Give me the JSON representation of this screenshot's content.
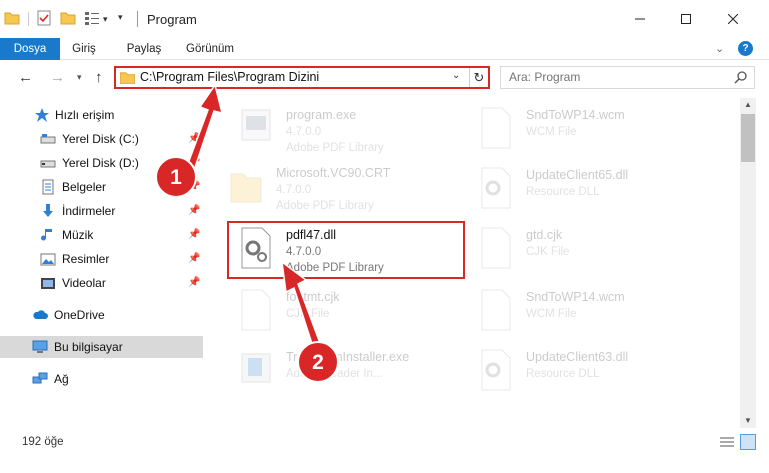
{
  "window": {
    "title": "Program"
  },
  "ribbon": {
    "tabs": [
      "Dosya",
      "Giriş",
      "Paylaş",
      "Görünüm"
    ]
  },
  "address": {
    "path": "C:\\Program Files\\Program Dizini"
  },
  "search": {
    "placeholder": "Ara: Program"
  },
  "sidebar": {
    "items": [
      {
        "label": "Hızlı erişim",
        "icon": "star-icon",
        "pinned": false
      },
      {
        "label": "Yerel Disk (C:)",
        "icon": "drive-icon",
        "pinned": true
      },
      {
        "label": "Yerel Disk (D:)",
        "icon": "drive-icon",
        "pinned": true
      },
      {
        "label": "Belgeler",
        "icon": "documents-icon",
        "pinned": true
      },
      {
        "label": "İndirmeler",
        "icon": "download-icon",
        "pinned": true
      },
      {
        "label": "Müzik",
        "icon": "music-icon",
        "pinned": true
      },
      {
        "label": "Resimler",
        "icon": "pictures-icon",
        "pinned": true
      },
      {
        "label": "Videolar",
        "icon": "videos-icon",
        "pinned": true
      },
      {
        "label": "OneDrive",
        "icon": "cloud-icon",
        "pinned": false
      },
      {
        "label": "Bu bilgisayar",
        "icon": "computer-icon",
        "pinned": false
      },
      {
        "label": "Ağ",
        "icon": "network-icon",
        "pinned": false
      }
    ]
  },
  "files": {
    "left": [
      {
        "name": "program.exe",
        "meta1": "4.7.0.0",
        "meta2": "Adobe PDF Library"
      },
      {
        "name": "Microsoft.VC90.CRT",
        "meta1": "4.7.0.0",
        "meta2": "Adobe PDF Library"
      },
      {
        "name": "pdfl47.dll",
        "meta1": "4.7.0.0",
        "meta2": "Adobe PDF Library"
      },
      {
        "name": "fontmt.cjk",
        "meta1": "CJK File",
        "meta2": ""
      },
      {
        "name": "TransformInstaller.exe",
        "meta1": "Adobe Reader In...",
        "meta2": ""
      }
    ],
    "right": [
      {
        "name": "SndToWP14.wcm",
        "meta1": "WCM File",
        "meta2": ""
      },
      {
        "name": "UpdateClient65.dll",
        "meta1": "Resource DLL",
        "meta2": ""
      },
      {
        "name": "gtd.cjk",
        "meta1": "CJK File",
        "meta2": ""
      },
      {
        "name": "SndToWP14.wcm",
        "meta1": "WCM File",
        "meta2": ""
      },
      {
        "name": "UpdateClient63.dll",
        "meta1": "Resource DLL",
        "meta2": ""
      }
    ]
  },
  "status": {
    "count": "192 öğe"
  },
  "annotations": {
    "step1": "1",
    "step2": "2"
  },
  "colors": {
    "accent": "#1979ca",
    "highlight": "#d92727"
  }
}
